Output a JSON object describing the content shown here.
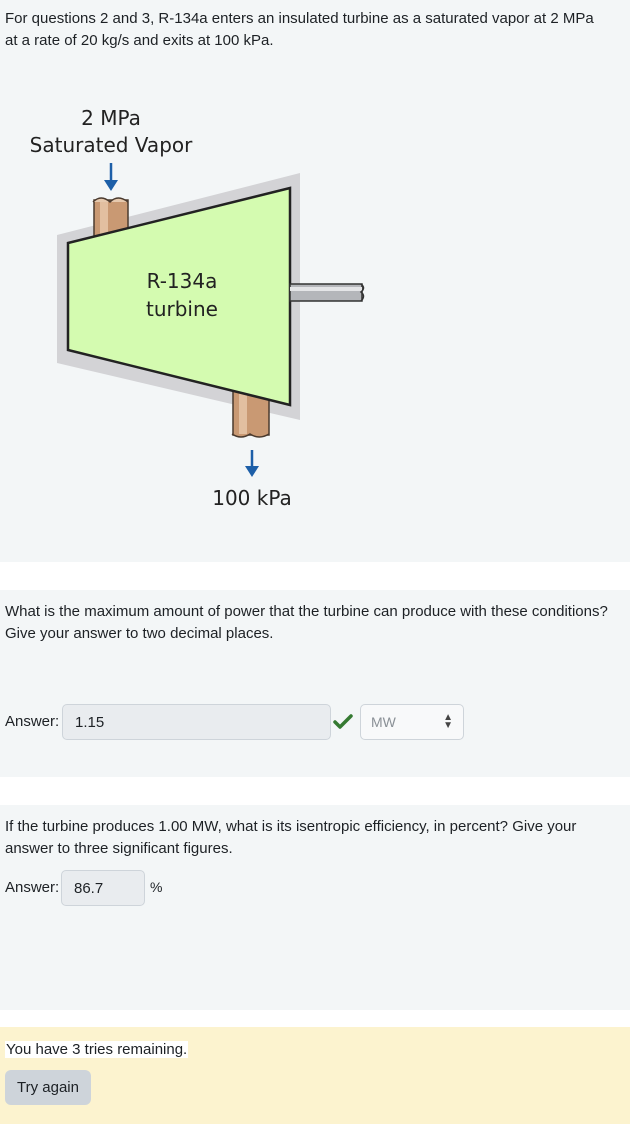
{
  "intro": {
    "text": "For questions 2 and 3, R-134a enters an insulated turbine as a saturated vapor at 2 MPa at a rate of 20 kg/s and exits at 100 kPa."
  },
  "diagram": {
    "inlet_line1": "2 MPa",
    "inlet_line2": "Saturated Vapor",
    "body_line1": "R-134a",
    "body_line2": "turbine",
    "outlet_label": "100 kPa",
    "colors": {
      "body_fill": "#d4fbb0",
      "shadow": "#d3d3d6",
      "pipe": "#c99973",
      "arrow": "#1d5fa8",
      "shaft": "#b4b6ba"
    }
  },
  "question2": {
    "text": "What is the maximum amount of power that the turbine can produce with these conditions? Give your answer to two decimal places.",
    "answer_label": "Answer:",
    "answer_value": "1.15",
    "unit_selected": "MW",
    "status_icon": "check-icon"
  },
  "question3": {
    "text": "If the turbine produces 1.00 MW, what is its isentropic efficiency, in percent? Give your answer to three significant figures.",
    "answer_label": "Answer:",
    "answer_value": "86.7",
    "unit": "%"
  },
  "feedback": {
    "tries_text": "You have 3 tries remaining.",
    "try_again_label": "Try again"
  }
}
